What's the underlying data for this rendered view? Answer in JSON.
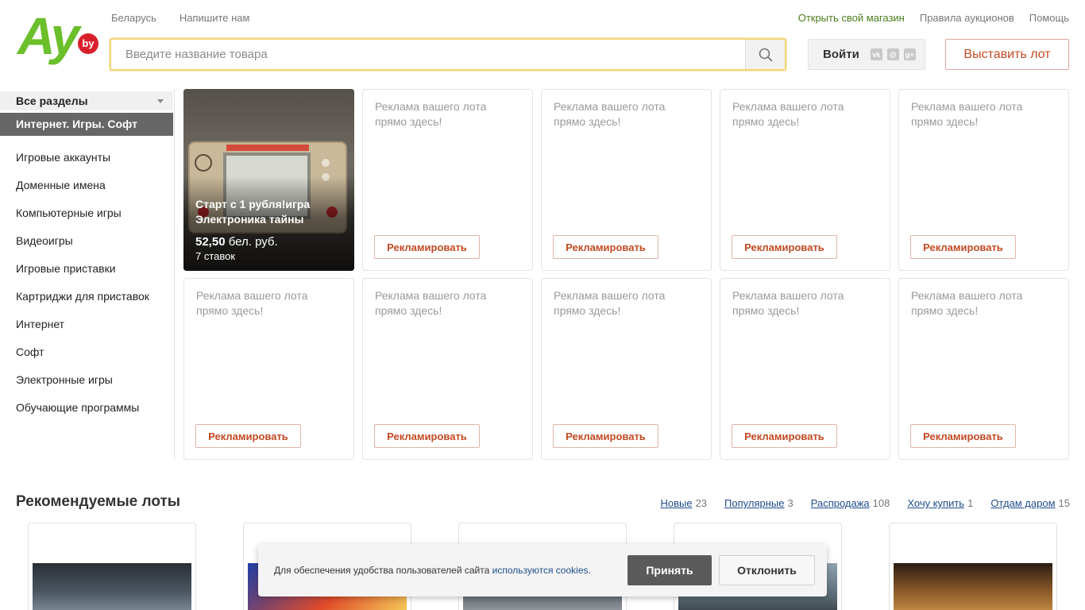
{
  "logo": {
    "text": "Ay",
    "badge": "by"
  },
  "header": {
    "left_links": [
      "Беларусь",
      "Напишите нам"
    ],
    "right_links": [
      {
        "label": "Открыть свой магазин",
        "color": "#4b7d1b"
      },
      {
        "label": "Правила аукционов"
      },
      {
        "label": "Помощь"
      }
    ],
    "search": {
      "placeholder": "Введите название товара",
      "value": ""
    },
    "login_label": "Войти",
    "social_icons": [
      "vk-icon",
      "mail-icon",
      "google-plus-icon"
    ],
    "place_lot_label": "Выставить лот"
  },
  "sidebar": {
    "all_sections": "Все разделы",
    "active_section": "Интернет. Игры. Софт",
    "items": [
      "Игровые аккаунты",
      "Доменные имена",
      "Компьютерные игры",
      "Видеоигры",
      "Игровые приставки",
      "Картриджи для приставок",
      "Интернет",
      "Софт",
      "Электронные игры",
      "Обучающие программы"
    ]
  },
  "featured_lot": {
    "title": "Старт с 1 рубля!игра Электроника тайны",
    "price_value": "52,50",
    "price_currency": "бел. руб.",
    "bids": "7 ставок"
  },
  "ad_slot": {
    "text": "Реклама вашего лота прямо здесь!",
    "button": "Рекламировать"
  },
  "recommended": {
    "title": "Рекомендуемые лоты",
    "tabs": [
      {
        "label": "Новые",
        "count": "23"
      },
      {
        "label": "Популярные",
        "count": "3"
      },
      {
        "label": "Распродажа",
        "count": "108"
      },
      {
        "label": "Хочу купить",
        "count": "1"
      },
      {
        "label": "Отдам даром",
        "count": "15"
      }
    ]
  },
  "cookie": {
    "text": "Для обеспечения удобства пользователей сайта",
    "link": "используются cookies",
    "suffix": ".",
    "accept": "Принять",
    "decline": "Отклонить"
  },
  "colors": {
    "brand_green": "#6bbf2a",
    "accent_orange": "#c34a22",
    "link_blue": "#1f4d8c"
  }
}
